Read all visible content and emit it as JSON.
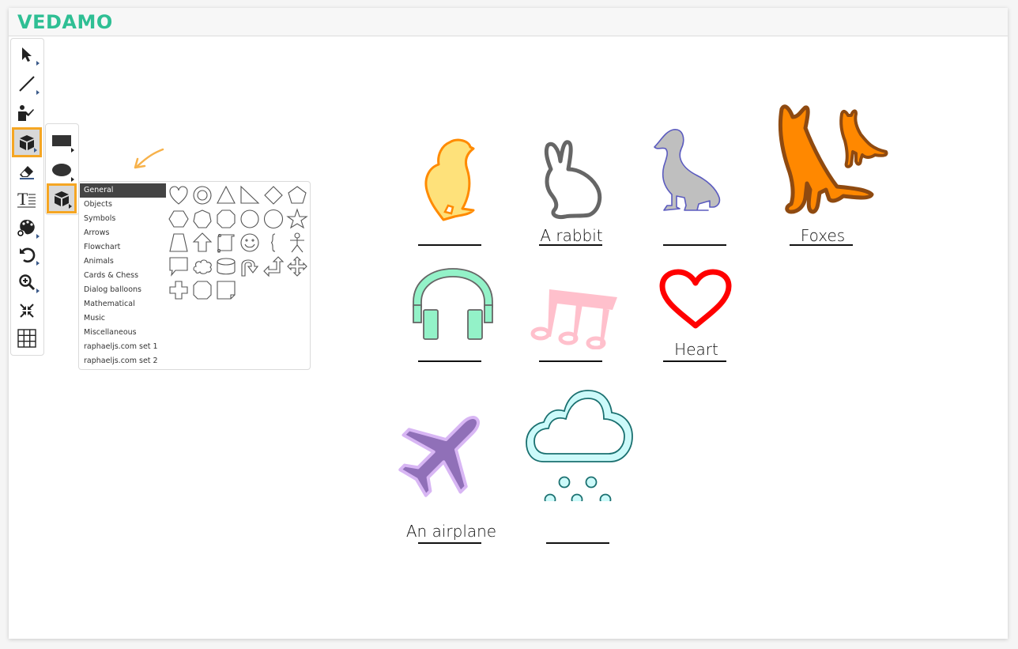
{
  "app": {
    "logo": "VEDAMO",
    "brand_color": "#2fbf94",
    "accent_color": "#f5a623"
  },
  "toolbar": {
    "tools": [
      {
        "name": "select",
        "icon": "cursor-arrow-icon",
        "has_submenu": true,
        "active": false
      },
      {
        "name": "line",
        "icon": "line-icon",
        "has_submenu": true,
        "active": false
      },
      {
        "name": "presenter",
        "icon": "presenter-icon",
        "has_submenu": false,
        "active": false
      },
      {
        "name": "shapes",
        "icon": "cube-icon",
        "has_submenu": true,
        "active": true
      },
      {
        "name": "eraser",
        "icon": "eraser-icon",
        "has_submenu": false,
        "active": false
      },
      {
        "name": "text",
        "icon": "text-icon",
        "has_submenu": false,
        "active": false
      },
      {
        "name": "color",
        "icon": "palette-icon",
        "has_submenu": true,
        "active": false
      },
      {
        "name": "undo",
        "icon": "undo-icon",
        "has_submenu": true,
        "active": false
      },
      {
        "name": "zoom",
        "icon": "zoom-in-icon",
        "has_submenu": true,
        "active": false
      },
      {
        "name": "fit",
        "icon": "compress-icon",
        "has_submenu": false,
        "active": false
      },
      {
        "name": "grid",
        "icon": "grid-icon",
        "has_submenu": false,
        "active": false
      }
    ]
  },
  "subtoolbar": {
    "items": [
      {
        "name": "rectangle",
        "icon": "rectangle-icon",
        "active": false
      },
      {
        "name": "ellipse",
        "icon": "ellipse-icon",
        "active": false
      },
      {
        "name": "shape-library",
        "icon": "cube-icon",
        "active": true
      }
    ]
  },
  "shape_panel": {
    "categories": [
      {
        "label": "General",
        "active": true
      },
      {
        "label": "Objects",
        "active": false
      },
      {
        "label": "Symbols",
        "active": false
      },
      {
        "label": "Arrows",
        "active": false
      },
      {
        "label": "Flowchart",
        "active": false
      },
      {
        "label": "Animals",
        "active": false
      },
      {
        "label": "Cards & Chess",
        "active": false
      },
      {
        "label": "Dialog balloons",
        "active": false
      },
      {
        "label": "Mathematical",
        "active": false
      },
      {
        "label": "Music",
        "active": false
      },
      {
        "label": "Miscellaneous",
        "active": false
      },
      {
        "label": "raphaeljs.com set 1",
        "active": false
      },
      {
        "label": "raphaeljs.com set 2",
        "active": false
      }
    ],
    "shapes": [
      "heart",
      "ring",
      "triangle",
      "right-triangle",
      "diamond",
      "pentagon",
      "hexagon",
      "heptagon",
      "octagon",
      "nonagon",
      "decagon",
      "star",
      "trapezoid",
      "arrow-up",
      "scroll",
      "smiley",
      "brace",
      "stick-figure",
      "speech-bubble",
      "cloud",
      "cylinder",
      "u-turn-arrow",
      "bent-arrow",
      "four-way-arrow",
      "cross",
      "chamfered-square",
      "folded-corner"
    ]
  },
  "canvas": {
    "items": [
      {
        "name": "chick",
        "label": ""
      },
      {
        "name": "rabbit",
        "label": "A rabbit"
      },
      {
        "name": "duck",
        "label": ""
      },
      {
        "name": "foxes",
        "label": "Foxes"
      },
      {
        "name": "headphones",
        "label": ""
      },
      {
        "name": "music-notes",
        "label": ""
      },
      {
        "name": "heart",
        "label": "Heart"
      },
      {
        "name": "airplane",
        "label": "An airplane"
      },
      {
        "name": "snow-cloud",
        "label": ""
      }
    ]
  }
}
